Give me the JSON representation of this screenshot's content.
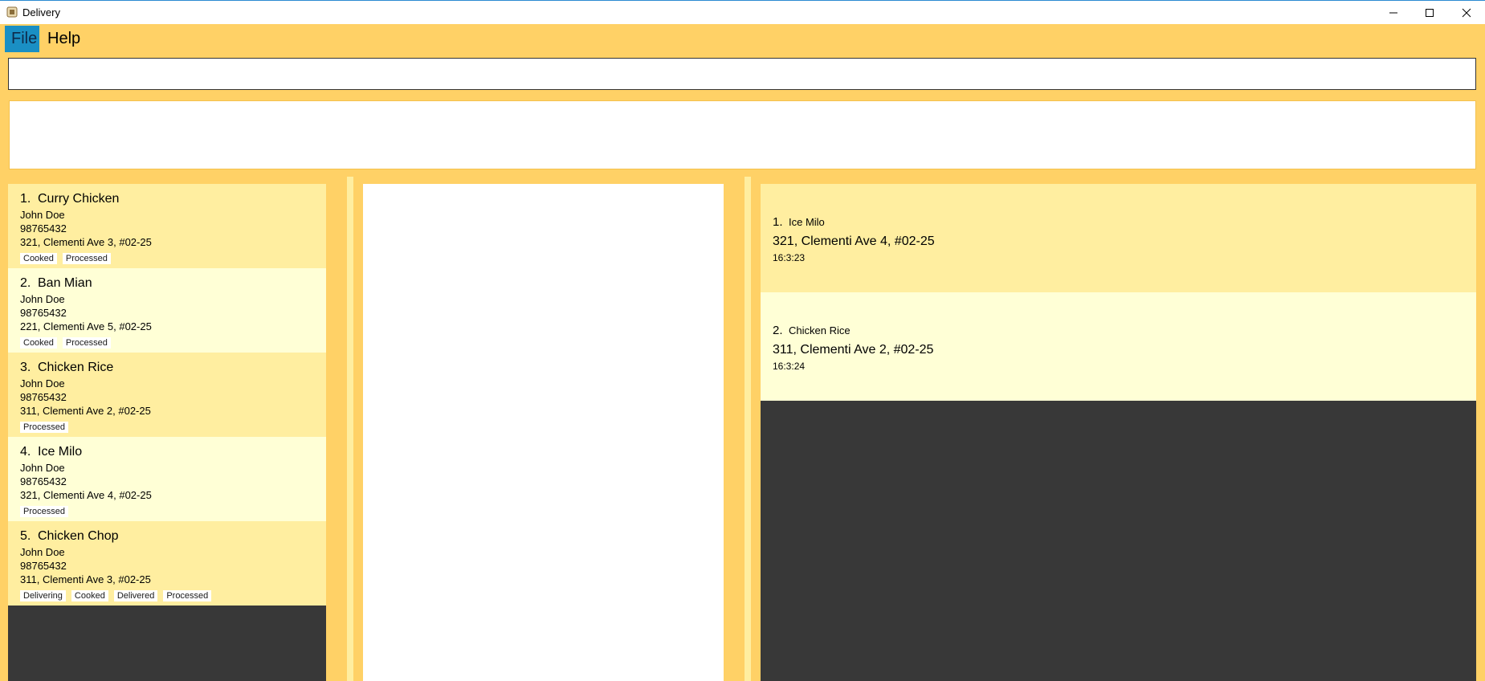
{
  "window": {
    "title": "Delivery"
  },
  "menu": {
    "file": "File",
    "help": "Help"
  },
  "command": {
    "value": "",
    "placeholder": ""
  },
  "orders": [
    {
      "index": "1.",
      "name": "Curry Chicken",
      "customer": "John Doe",
      "phone": "98765432",
      "address": "321, Clementi Ave 3, #02-25",
      "tags": [
        "Cooked",
        "Processed"
      ]
    },
    {
      "index": "2.",
      "name": "Ban Mian",
      "customer": "John Doe",
      "phone": "98765432",
      "address": "221, Clementi Ave 5, #02-25",
      "tags": [
        "Cooked",
        "Processed"
      ]
    },
    {
      "index": "3.",
      "name": "Chicken Rice",
      "customer": "John Doe",
      "phone": "98765432",
      "address": "311, Clementi Ave 2, #02-25",
      "tags": [
        "Processed"
      ]
    },
    {
      "index": "4.",
      "name": "Ice Milo",
      "customer": "John Doe",
      "phone": "98765432",
      "address": "321, Clementi Ave 4, #02-25",
      "tags": [
        "Processed"
      ]
    },
    {
      "index": "5.",
      "name": "Chicken Chop",
      "customer": "John Doe",
      "phone": "98765432",
      "address": "311, Clementi Ave 3, #02-25",
      "tags": [
        "Delivering",
        "Cooked",
        "Delivered",
        "Processed"
      ]
    }
  ],
  "deliveries": [
    {
      "index": "1.",
      "name": "Ice Milo",
      "address": "321, Clementi Ave 4, #02-25",
      "time": "16:3:23"
    },
    {
      "index": "2.",
      "name": "Chicken Rice",
      "address": "311, Clementi Ave 2, #02-25",
      "time": "16:3:24"
    }
  ]
}
